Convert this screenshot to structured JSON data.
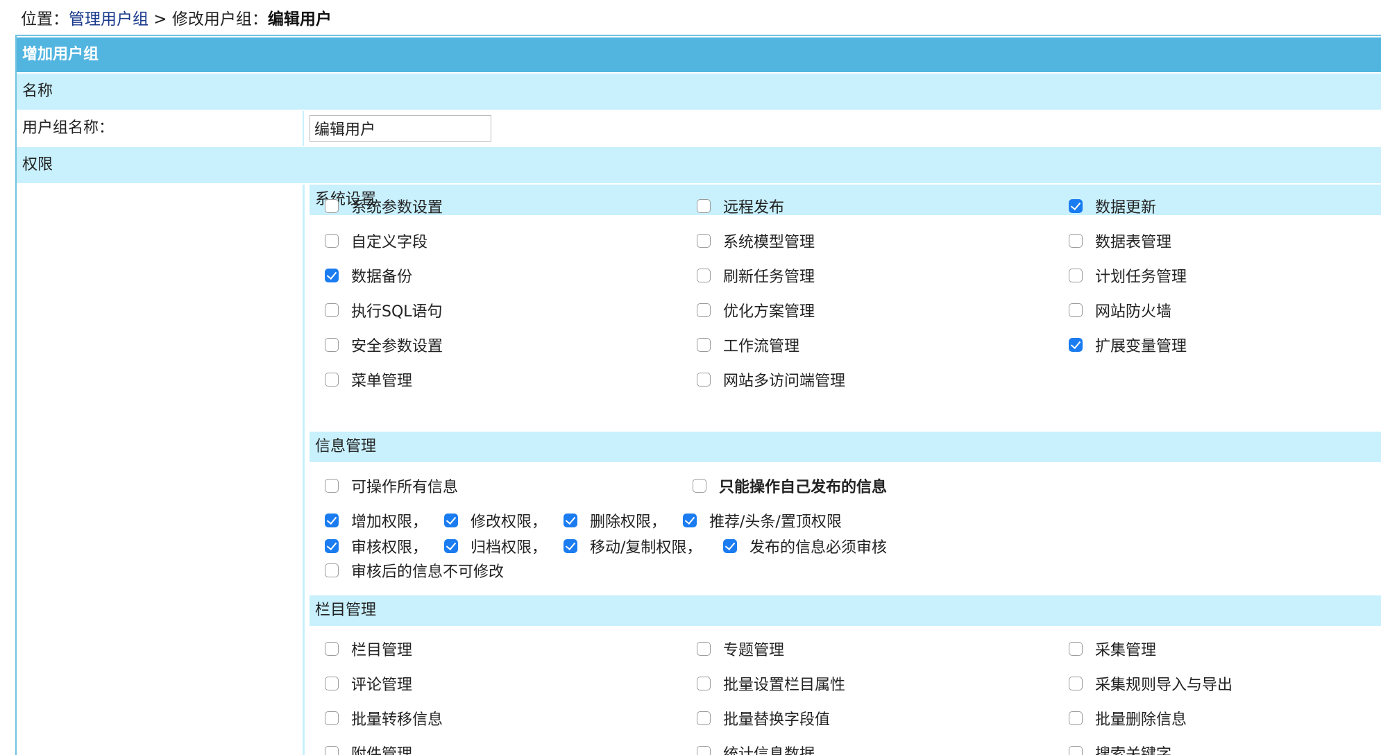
{
  "breadcrumb": {
    "prefix": "位置：",
    "link": "管理用户组",
    "separator": " > ",
    "middle": "修改用户组：",
    "current": "编辑用户"
  },
  "form": {
    "header": "增加用户组",
    "name_section": "名称",
    "name_label": "用户组名称：",
    "name_value": "编辑用户",
    "perm_section": "权限"
  },
  "system_settings": {
    "title": "系统设置",
    "items": [
      {
        "label": "系统参数设置",
        "checked": false
      },
      {
        "label": "远程发布",
        "checked": false
      },
      {
        "label": "数据更新",
        "checked": true
      },
      {
        "label": "自定义字段",
        "checked": false
      },
      {
        "label": "系统模型管理",
        "checked": false
      },
      {
        "label": "数据表管理",
        "checked": false
      },
      {
        "label": "数据备份",
        "checked": true
      },
      {
        "label": "刷新任务管理",
        "checked": false
      },
      {
        "label": "计划任务管理",
        "checked": false
      },
      {
        "label": "执行SQL语句",
        "checked": false
      },
      {
        "label": "优化方案管理",
        "checked": false
      },
      {
        "label": "网站防火墙",
        "checked": false
      },
      {
        "label": "安全参数设置",
        "checked": false
      },
      {
        "label": "工作流管理",
        "checked": false
      },
      {
        "label": "扩展变量管理",
        "checked": true
      },
      {
        "label": "菜单管理",
        "checked": false
      },
      {
        "label": "网站多访问端管理",
        "checked": false
      }
    ]
  },
  "info_management": {
    "title": "信息管理",
    "scope": [
      {
        "label": "可操作所有信息",
        "checked": false
      },
      {
        "label": "只能操作自己发布的信息",
        "checked": false
      }
    ],
    "rights_row1": [
      {
        "label": "增加权限，",
        "checked": true
      },
      {
        "label": "修改权限，",
        "checked": true
      },
      {
        "label": "删除权限，",
        "checked": true
      },
      {
        "label": "推荐/头条/置顶权限",
        "checked": true
      }
    ],
    "rights_row2": [
      {
        "label": "审核权限，",
        "checked": true
      },
      {
        "label": "归档权限，",
        "checked": true
      },
      {
        "label": "移动/复制权限，",
        "checked": true
      },
      {
        "label": "发布的信息必须审核",
        "checked": true
      }
    ],
    "rights_row3": [
      {
        "label": "审核后的信息不可修改",
        "checked": false
      }
    ]
  },
  "column_management": {
    "title": "栏目管理",
    "items": [
      {
        "label": "栏目管理",
        "checked": false
      },
      {
        "label": "专题管理",
        "checked": false
      },
      {
        "label": "采集管理",
        "checked": false
      },
      {
        "label": "评论管理",
        "checked": false
      },
      {
        "label": "批量设置栏目属性",
        "checked": false
      },
      {
        "label": "采集规则导入与导出",
        "checked": false
      },
      {
        "label": "批量转移信息",
        "checked": false
      },
      {
        "label": "批量替换字段值",
        "checked": false
      },
      {
        "label": "批量删除信息",
        "checked": false
      },
      {
        "label": "附件管理",
        "checked": false
      },
      {
        "label": "统计信息数据",
        "checked": false
      },
      {
        "label": "搜索关键字",
        "checked": false
      }
    ]
  }
}
